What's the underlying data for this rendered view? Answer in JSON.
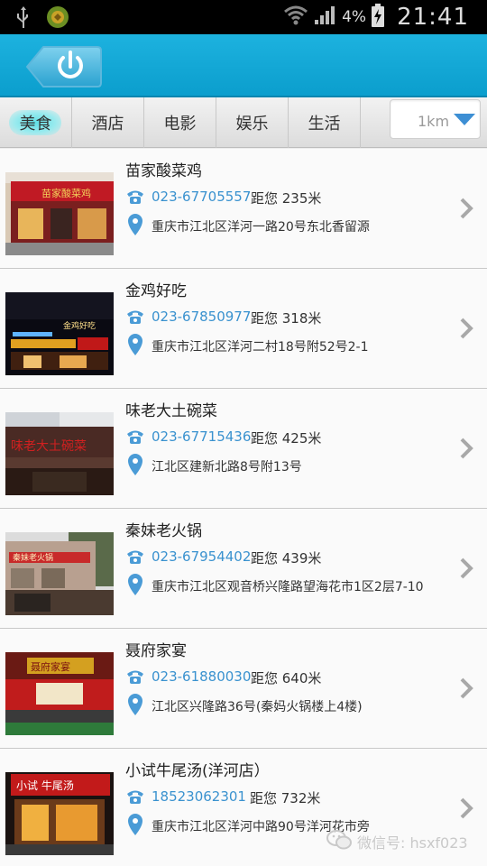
{
  "status_bar": {
    "battery_percent": "4%",
    "time": "21:41"
  },
  "tabs": [
    {
      "label": "美食",
      "active": true
    },
    {
      "label": "酒店",
      "active": false
    },
    {
      "label": "电影",
      "active": false
    },
    {
      "label": "娱乐",
      "active": false
    },
    {
      "label": "生活",
      "active": false
    }
  ],
  "distance_filter": {
    "value": "1km"
  },
  "restaurants": [
    {
      "name": "苗家酸菜鸡",
      "phone": "023-67705557",
      "distance": "距您 235米",
      "address": "重庆市江北区洋河一路20号东北香留源"
    },
    {
      "name": "金鸡好吃",
      "phone": "023-67850977",
      "distance": "距您 318米",
      "address": "重庆市江北区洋河二村18号附52号2-1"
    },
    {
      "name": "味老大土碗菜",
      "phone": "023-67715436",
      "distance": "距您 425米",
      "address": "江北区建新北路8号附13号"
    },
    {
      "name": "秦妹老火锅",
      "phone": "023-67954402",
      "distance": "距您 439米",
      "address": "重庆市江北区观音桥兴隆路望海花市1区2层7-10"
    },
    {
      "name": "聂府家宴",
      "phone": "023-61880030",
      "distance": "距您 640米",
      "address": "江北区兴隆路36号(秦妈火锅楼上4楼)"
    },
    {
      "name": "小试牛尾汤(洋河店）",
      "phone": "18523062301",
      "distance": "距您 732米",
      "address": "重庆市江北区洋河中路90号洋河花市旁"
    }
  ],
  "thumbnail_signs": [
    "苗家酸菜鸡",
    "金鸡好吃",
    "味老大土碗菜",
    "秦妹老火锅",
    "聂府家宴",
    "小试 牛尾汤"
  ],
  "watermark": {
    "text": "微信号: hsxf023"
  },
  "colors": {
    "header": "#11a7d8",
    "phone_text": "#3a92cf",
    "icon_blue": "#4a9bd6"
  }
}
